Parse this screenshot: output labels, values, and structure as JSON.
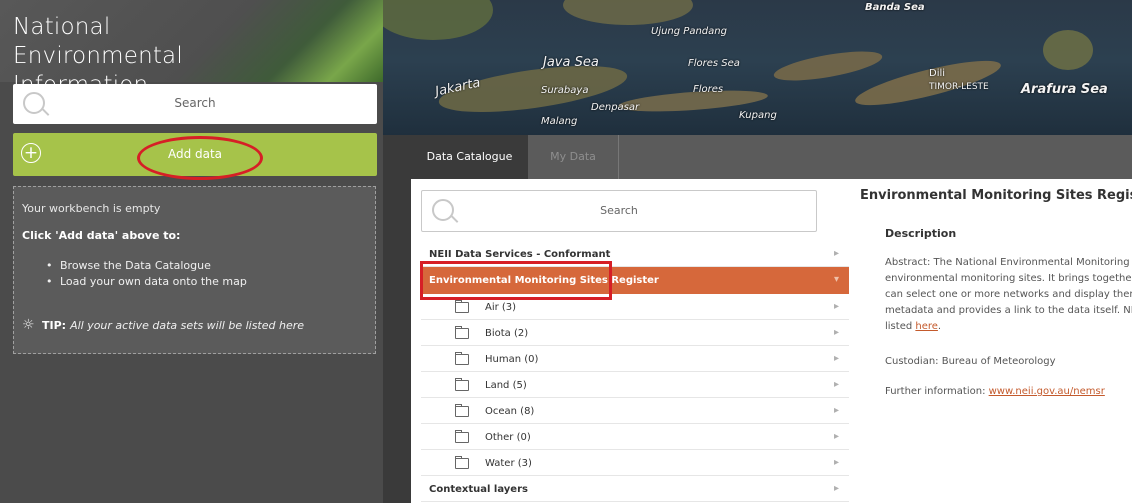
{
  "app": {
    "title_line1": "National Environmental",
    "title_line2": "Information Infrastructure"
  },
  "sidebar": {
    "search_placeholder": "Search",
    "add_data_label": "Add data",
    "workbench": {
      "empty_text": "Your workbench is empty",
      "click_text": "Click 'Add data' above to:",
      "bullets": [
        "Browse the Data Catalogue",
        "Load your own data onto the map"
      ],
      "tip_label": "TIP:",
      "tip_text": "All your active data sets will be listed here"
    }
  },
  "map": {
    "labels": {
      "banda_sea": "Banda Sea",
      "flores_sea": "Flores Sea",
      "flores": "Flores",
      "ujung_pandang": "Ujung Pandang",
      "jakarta": "Jakarta",
      "java_sea": "Java Sea",
      "surabaya": "Surabaya",
      "denpasar": "Denpasar",
      "malang": "Malang",
      "kupang": "Kupang",
      "dili": "Dili",
      "timor_leste": "TIMOR-LESTE",
      "arafura_sea": "Arafura Sea"
    }
  },
  "catalogue": {
    "tabs": [
      {
        "label": "Data Catalogue",
        "active": true
      },
      {
        "label": "My Data",
        "active": false
      }
    ],
    "search_placeholder": "Search",
    "items": [
      {
        "label": "NEII Data Services - Conformant",
        "level": 0
      },
      {
        "label": "Environmental Monitoring Sites Register",
        "level": 0,
        "selected": true
      },
      {
        "label": "Air (3)",
        "level": 1
      },
      {
        "label": "Biota (2)",
        "level": 1
      },
      {
        "label": "Human (0)",
        "level": 1
      },
      {
        "label": "Land (5)",
        "level": 1
      },
      {
        "label": "Ocean (8)",
        "level": 1
      },
      {
        "label": "Other (0)",
        "level": 1
      },
      {
        "label": "Water (3)",
        "level": 1
      },
      {
        "label": "Contextual layers",
        "level": 0
      }
    ],
    "details": {
      "title": "Environmental Monitoring Sites Register",
      "description_heading": "Description",
      "abstract_line1": "Abstract: The National Environmental Monitoring Si",
      "abstract_line2": "environmental monitoring sites. It brings together a",
      "abstract_line3": "can select one or more networks and display them",
      "abstract_line4": "metadata and provides a link to the data itself. NEM",
      "abstract_line5_prefix": "listed ",
      "abstract_link": "here",
      "abstract_line5_suffix": ".",
      "custodian": "Custodian: Bureau of Meteorology",
      "further_prefix": "Further information: ",
      "further_link": "www.neii.gov.au/nemsr"
    }
  },
  "colors": {
    "add_data_green": "#a6c34a",
    "selected_orange": "#d6683b",
    "annotation_red": "#d61f26",
    "sidebar_bg": "#4b4b4b"
  }
}
